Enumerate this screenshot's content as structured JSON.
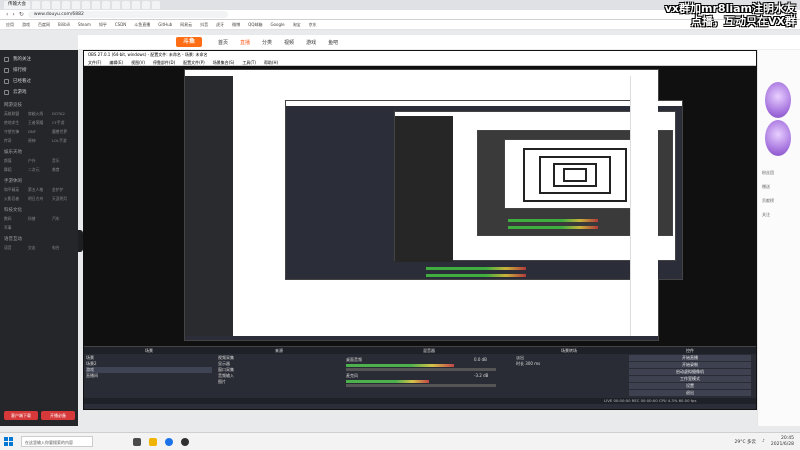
{
  "browser": {
    "tabs": [
      "传输大会",
      "",
      "",
      "",
      "",
      "",
      "",
      "",
      "",
      "",
      "",
      "",
      "",
      "",
      "",
      "",
      "",
      "",
      ""
    ],
    "address": "www.douyu.com/6882",
    "bookmarks": [
      "应用",
      "游戏",
      "百度网",
      "Bilibili",
      "Steam",
      "知乎",
      "CSDN",
      "斗鱼直播",
      "GitHub",
      "网易云",
      "抖音",
      "虎牙",
      "微博",
      "QQ邮箱",
      "Google",
      "淘宝",
      "京东"
    ]
  },
  "overlay": {
    "line1": "vx群加mr8liam注明水友",
    "line2": "点播，互动只在VX群"
  },
  "site": {
    "logo": "斗鱼",
    "nav": [
      "首页",
      "直播",
      "分类",
      "视频",
      "游戏",
      "鱼吧"
    ],
    "active_index": 1
  },
  "sidebar": {
    "items": [
      "我的关注",
      "排行榜",
      "已经看过",
      "云游戏"
    ],
    "sections": [
      {
        "title": "网游竞技",
        "entries": [
          "英雄联盟",
          "穿越火线",
          "DOTA2",
          "绝地求生",
          "王者荣耀",
          "CF手游",
          "守望先锋",
          "DNF",
          "魔兽世界",
          "传奇",
          "原神",
          "LOL手游"
        ]
      },
      {
        "title": "娱乐天地",
        "entries": [
          "颜值",
          "户外",
          "音乐",
          "舞蹈",
          "二次元",
          "美食"
        ]
      },
      {
        "title": "手游休闲",
        "entries": [
          "和平精英",
          "第五人格",
          "金铲铲",
          "火影忍者",
          "明日方舟",
          "天涯明月"
        ]
      },
      {
        "title": "科技文化",
        "entries": [
          "数码",
          "科普",
          "汽车",
          "军事"
        ]
      },
      {
        "title": "语音互动",
        "entries": [
          "语音",
          "交友",
          "电台"
        ]
      }
    ],
    "buttons": [
      "客户端下载",
      "开播必备"
    ]
  },
  "obs": {
    "title": "OBS 27.0.1 (64-bit, windows) - 配置文件: 未命名 - 场景: 未命名",
    "menu": [
      "文件(F)",
      "编辑(E)",
      "视图(V)",
      "停靠部件(D)",
      "配置文件(P)",
      "场景集合(S)",
      "工具(T)",
      "帮助(H)"
    ],
    "panel_headers": [
      "场景",
      "来源",
      "混音器",
      "场景转场",
      "控件"
    ],
    "scenes": [
      "场景",
      "场景2",
      "游戏",
      "直播间"
    ],
    "sources": [
      "视频采集",
      "显示器",
      "窗口采集",
      "音频输入",
      "图片"
    ],
    "mixer": [
      {
        "name": "桌面音频",
        "db": "0.0 dB",
        "level": 0.72
      },
      {
        "name": "麦克风",
        "db": "-3.2 dB",
        "level": 0.55
      }
    ],
    "transition": {
      "type": "淡出",
      "duration_label": "时长",
      "duration": "300 ms"
    },
    "controls": [
      "开始直播",
      "开始录制",
      "启动虚拟摄像机",
      "工作室模式",
      "设置",
      "退出"
    ],
    "status": "LIVE 00:00:00  REC 00:00:00  CPU 4.3%  60.00 fps"
  },
  "rpanel": {
    "texts": [
      "粉丝团",
      "赠送",
      "贡献榜",
      "关注"
    ]
  },
  "taskbar": {
    "search_placeholder": "在这里输入你要搜索的内容",
    "weather": "29°C 多云",
    "time": "20:45",
    "date": "2021/6/28"
  }
}
